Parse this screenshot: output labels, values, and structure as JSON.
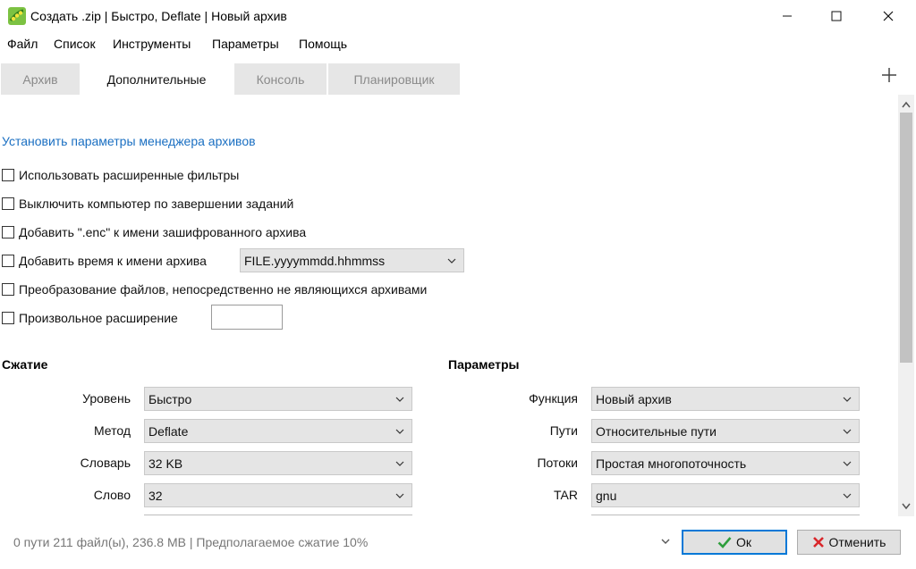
{
  "window": {
    "title": "Создать .zip | Быстро, Deflate | Новый архив",
    "app_icon": "pea-icon"
  },
  "menu": [
    "Файл",
    "Список",
    "Инструменты",
    "Параметры",
    "Помощь"
  ],
  "tabs": [
    {
      "label": "Архив",
      "active": false
    },
    {
      "label": "Дополнительные",
      "active": true
    },
    {
      "label": "Консоль",
      "active": false
    },
    {
      "label": "Планировщик",
      "active": false
    }
  ],
  "settings_link": "Установить параметры менеджера архивов",
  "options": [
    {
      "label": "Использовать расширенные фильтры",
      "checked": false
    },
    {
      "label": "Выключить компьютер по завершении заданий",
      "checked": false
    },
    {
      "label": "Добавить \".enc\" к имени зашифрованного архива",
      "checked": false
    },
    {
      "label": "Добавить время к имени архива",
      "checked": false
    },
    {
      "label": "Преобразование файлов, непосредственно не являющихся архивами",
      "checked": false
    },
    {
      "label": "Произвольное расширение",
      "checked": false
    }
  ],
  "time_format": "FILE.yyyymmdd.hhmmss",
  "custom_extension": "",
  "compression": {
    "heading": "Сжатие",
    "fields": [
      {
        "label": "Уровень",
        "value": "Быстро"
      },
      {
        "label": "Метод",
        "value": "Deflate"
      },
      {
        "label": "Словарь",
        "value": "32 KB"
      },
      {
        "label": "Слово",
        "value": "32"
      }
    ]
  },
  "parameters": {
    "heading": "Параметры",
    "fields": [
      {
        "label": "Функция",
        "value": "Новый архив"
      },
      {
        "label": "Пути",
        "value": "Относительные пути"
      },
      {
        "label": "Потоки",
        "value": "Простая многопоточность"
      },
      {
        "label": "TAR",
        "value": "gnu"
      }
    ]
  },
  "status": "0 пути 211 файл(ы), 236.8 MB | Предполагаемое сжатие 10%",
  "buttons": {
    "ok": "Ок",
    "cancel": "Отменить"
  },
  "colors": {
    "link": "#1a6fc2",
    "ok_icon": "#2e9e3c",
    "cancel_icon": "#d9262a",
    "focus": "#0078d7"
  }
}
